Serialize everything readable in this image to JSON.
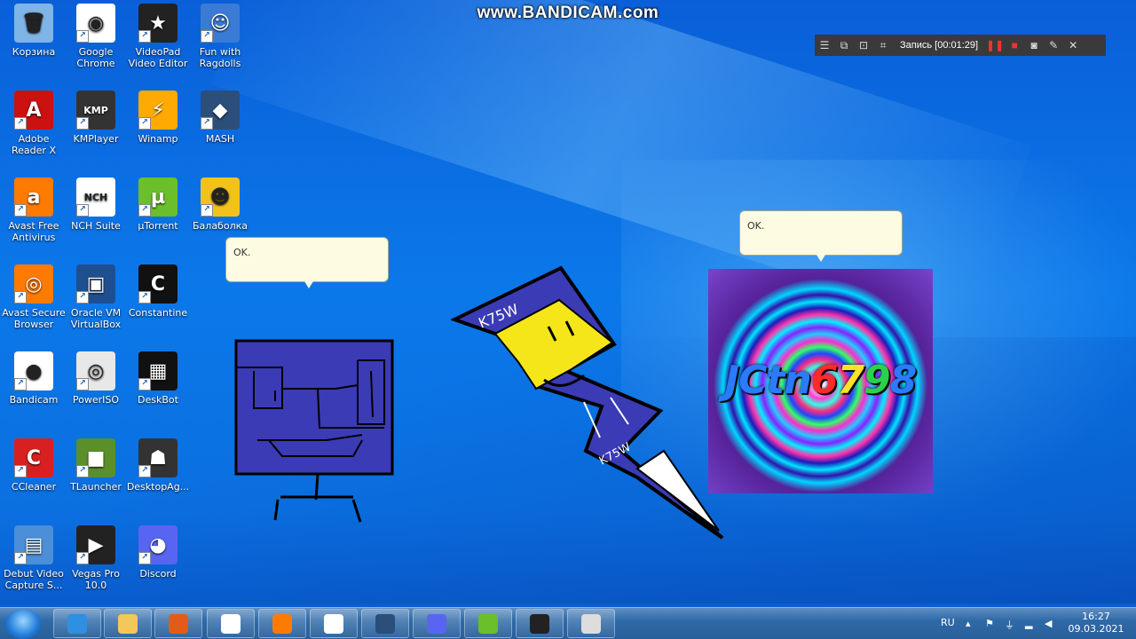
{
  "watermark": "www.BANDICAM.com",
  "recorder": {
    "status": "Запись [00:01:29]"
  },
  "desktop_icons": [
    {
      "label": "Корзина",
      "color": "#7fb4e6",
      "glyph": "🗑"
    },
    {
      "label": "Google Chrome",
      "color": "#ffffff",
      "glyph": "◉"
    },
    {
      "label": "VideoPad Video Editor",
      "color": "#222222",
      "glyph": "★"
    },
    {
      "label": "Fun with Ragdolls",
      "color": "#3a7bd5",
      "glyph": "☺"
    },
    {
      "label": "Adobe Reader X",
      "color": "#cc1111",
      "glyph": "A"
    },
    {
      "label": "KMPlayer",
      "color": "#333333",
      "glyph": "KMP"
    },
    {
      "label": "Winamp",
      "color": "#ffaa00",
      "glyph": "⚡"
    },
    {
      "label": "MASH",
      "color": "#2b4f7a",
      "glyph": "◆"
    },
    {
      "label": "Avast Free Antivirus",
      "color": "#ff7a00",
      "glyph": "a"
    },
    {
      "label": "NCH Suite",
      "color": "#ffffff",
      "glyph": "NCH"
    },
    {
      "label": "µTorrent",
      "color": "#6bbf2a",
      "glyph": "µ"
    },
    {
      "label": "Балаболка",
      "color": "#f2c21b",
      "glyph": "☻"
    },
    {
      "label": "Avast Secure Browser",
      "color": "#ff7a00",
      "glyph": "◎"
    },
    {
      "label": "Oracle VM VirtualBox",
      "color": "#1f4f8f",
      "glyph": "▣"
    },
    {
      "label": "Constantine",
      "color": "#111111",
      "glyph": "C"
    },
    {
      "label": "Bandicam",
      "color": "#ffffff",
      "glyph": "●"
    },
    {
      "label": "PowerISO",
      "color": "#e8e8e8",
      "glyph": "◎"
    },
    {
      "label": "DeskBot",
      "color": "#111111",
      "glyph": "▦"
    },
    {
      "label": "CCleaner",
      "color": "#d82020",
      "glyph": "C"
    },
    {
      "label": "TLauncher",
      "color": "#5a8f2a",
      "glyph": "■"
    },
    {
      "label": "DesktopAg...",
      "color": "#333333",
      "glyph": "☗"
    },
    {
      "label": "Debut Video Capture S...",
      "color": "#4a8fd8",
      "glyph": "▤"
    },
    {
      "label": "Vegas Pro 10.0",
      "color": "#222222",
      "glyph": "▶"
    },
    {
      "label": "Discord",
      "color": "#5865f2",
      "glyph": "◕"
    }
  ],
  "bubbles": {
    "left": "OK.",
    "right": "OK."
  },
  "character_left": {
    "body_color": "#3b3bb5"
  },
  "character_center": {
    "top_text": "K75W",
    "bottom_text": "K75W",
    "accent": "#f5e61a",
    "body_color": "#3b3bb5"
  },
  "avatar": {
    "text_parts": [
      "JCtn",
      "6",
      "7",
      "9",
      "8"
    ]
  },
  "taskbar": {
    "apps": [
      {
        "name": "internet-explorer",
        "color": "#2f8fe0"
      },
      {
        "name": "file-explorer",
        "color": "#f2c85a"
      },
      {
        "name": "videopad",
        "color": "#e25b1a"
      },
      {
        "name": "chrome",
        "color": "#ffffff"
      },
      {
        "name": "avast-browser",
        "color": "#ff7a00"
      },
      {
        "name": "bandicam",
        "color": "#ffffff"
      },
      {
        "name": "mash",
        "color": "#2b4f7a"
      },
      {
        "name": "discord",
        "color": "#5865f2"
      },
      {
        "name": "utorrent",
        "color": "#6bbf2a"
      },
      {
        "name": "terminal",
        "color": "#222222"
      },
      {
        "name": "film-app",
        "color": "#dddddd"
      }
    ],
    "language": "RU",
    "time": "16:27",
    "date": "09.03.2021"
  }
}
